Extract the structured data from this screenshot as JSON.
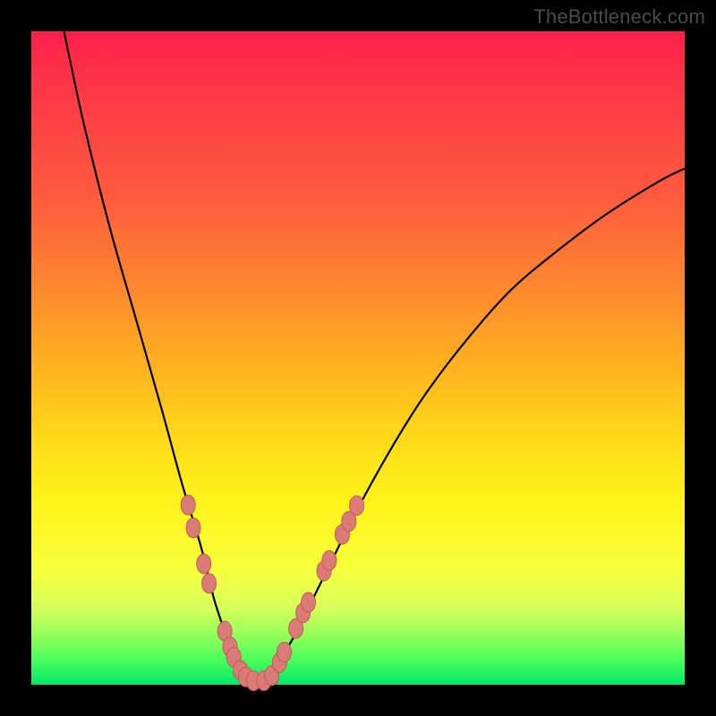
{
  "watermark": "TheBottleneck.com",
  "colors": {
    "frame": "#000000",
    "curve": "#000000",
    "dot_fill": "#da7b77",
    "dot_stroke": "#c05a57"
  },
  "chart_data": {
    "type": "line",
    "title": "",
    "xlabel": "",
    "ylabel": "",
    "xlim": [
      0,
      100
    ],
    "ylim": [
      0,
      100
    ],
    "note": "Axes have no visible numeric tick labels; values are normalized 0–100 to the plot area. y=0 is the bottom (green) edge, y=100 is the top (red) edge.",
    "series": [
      {
        "name": "bottleneck-curve",
        "x": [
          5,
          8,
          12,
          16,
          20,
          23,
          26,
          28,
          30,
          31.5,
          33,
          34.5,
          36,
          40,
          45,
          50,
          55,
          60,
          66,
          73,
          80,
          88,
          96,
          100
        ],
        "y": [
          100,
          86,
          70,
          56,
          42,
          31,
          21,
          13,
          7,
          3,
          1,
          0.5,
          1,
          7,
          17,
          27,
          36,
          44,
          52,
          60,
          66,
          72,
          77,
          79
        ]
      }
    ],
    "dots": {
      "name": "highlight-dots",
      "points": [
        {
          "x": 24.0,
          "y": 27.5
        },
        {
          "x": 24.8,
          "y": 24.0
        },
        {
          "x": 26.4,
          "y": 18.5
        },
        {
          "x": 27.2,
          "y": 15.5
        },
        {
          "x": 29.6,
          "y": 8.2
        },
        {
          "x": 30.4,
          "y": 5.8
        },
        {
          "x": 31.0,
          "y": 4.2
        },
        {
          "x": 32.0,
          "y": 2.2
        },
        {
          "x": 32.8,
          "y": 1.2
        },
        {
          "x": 34.0,
          "y": 0.6
        },
        {
          "x": 35.6,
          "y": 0.6
        },
        {
          "x": 36.8,
          "y": 1.4
        },
        {
          "x": 38.0,
          "y": 3.4
        },
        {
          "x": 38.7,
          "y": 5.0
        },
        {
          "x": 40.5,
          "y": 8.6
        },
        {
          "x": 41.6,
          "y": 11.0
        },
        {
          "x": 42.4,
          "y": 12.6
        },
        {
          "x": 44.8,
          "y": 17.4
        },
        {
          "x": 45.6,
          "y": 19.0
        },
        {
          "x": 47.6,
          "y": 23.0
        },
        {
          "x": 48.6,
          "y": 25.0
        },
        {
          "x": 49.8,
          "y": 27.4
        }
      ]
    }
  }
}
